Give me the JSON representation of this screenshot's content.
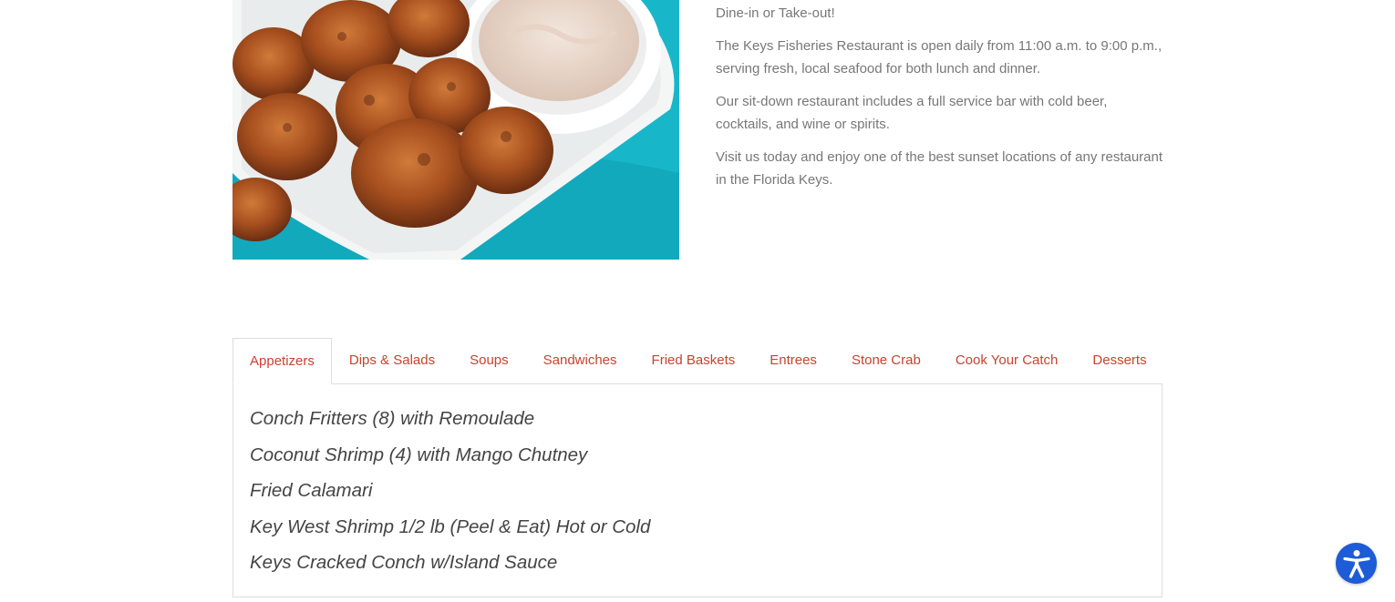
{
  "intro": {
    "paragraphs": [
      "Dine-in or Take-out!",
      "The Keys Fisheries Restaurant is open daily from 11:00 a.m. to 9:00 p.m., serving fresh, local seafood for both lunch and dinner.",
      "Our sit-down restaurant includes a full service bar with cold beer, cocktails, and wine or spirits.",
      "Visit us today and enjoy one of the best sunset locations of any restaurant in the Florida Keys."
    ]
  },
  "menu_tabs": [
    {
      "label": "Appetizers",
      "active": true
    },
    {
      "label": "Dips & Salads",
      "active": false
    },
    {
      "label": "Soups",
      "active": false
    },
    {
      "label": "Sandwiches",
      "active": false
    },
    {
      "label": "Fried Baskets",
      "active": false
    },
    {
      "label": "Entrees",
      "active": false
    },
    {
      "label": "Stone Crab",
      "active": false
    },
    {
      "label": "Cook Your Catch",
      "active": false
    },
    {
      "label": "Desserts",
      "active": false
    }
  ],
  "appetizers": [
    "Conch Fritters (8) with Remoulade",
    "Coconut Shrimp (4) with Mango Chutney",
    "Fried Calamari",
    "Key West Shrimp 1/2 lb (Peel & Eat) Hot or Cold",
    "Keys Cracked Conch w/Island Sauce"
  ],
  "colors": {
    "tab_link": "#c8432d",
    "body_text": "#777777",
    "menu_text": "#444444",
    "border": "#dddddd",
    "accessibility_button": "#1e5bd6",
    "photo_background": "#17b7c9"
  },
  "icons": {
    "accessibility": "accessibility-person-icon"
  }
}
